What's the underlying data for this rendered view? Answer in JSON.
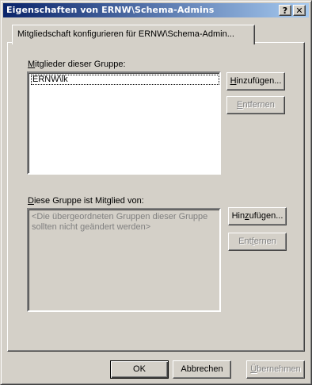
{
  "window": {
    "title": "Eigenschaften von ERNW\\Schema-Admins",
    "help_glyph": "?",
    "close_glyph": "✕"
  },
  "tab": {
    "label": "Mitgliedschaft konfigurieren für ERNW\\Schema-Admin..."
  },
  "members": {
    "label_accel": "M",
    "label_rest": "itglieder dieser Gruppe:",
    "items": [
      "ERNW\\lk"
    ],
    "add": {
      "pre": "",
      "accel": "H",
      "post": "inzufügen..."
    },
    "remove": {
      "pre": "",
      "accel": "E",
      "post": "ntfernen"
    }
  },
  "memberof": {
    "label_accel": "D",
    "label_rest": "iese Gruppe ist Mitglied von:",
    "placeholder_line1": "<Die übergeordneten Gruppen dieser Gruppe",
    "placeholder_line2": "sollten nicht geändert werden>",
    "add": {
      "pre": "Hin",
      "accel": "z",
      "post": "ufügen..."
    },
    "remove": {
      "pre": "Ent",
      "accel": "f",
      "post": "ernen"
    }
  },
  "footer": {
    "ok": "OK",
    "cancel": "Abbrechen",
    "apply": {
      "pre": "",
      "accel": "Ü",
      "post": "bernehmen"
    }
  }
}
